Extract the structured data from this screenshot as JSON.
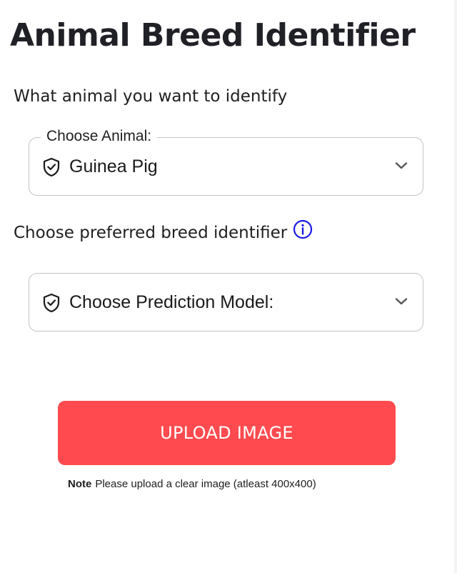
{
  "header": {
    "title": "Animal Breed Identifier"
  },
  "animal_section": {
    "label": "What animal you want to identify",
    "select": {
      "legend": "Choose Animal:",
      "selected_value": "Guinea Pig",
      "leading_icon": "shield-check-icon",
      "trailing_icon": "chevron-down-icon"
    }
  },
  "model_section": {
    "label": "Choose preferred breed identifier",
    "info_icon": "info-circle-icon",
    "select": {
      "placeholder": "Choose Prediction Model:",
      "leading_icon": "shield-check-icon",
      "trailing_icon": "chevron-down-icon"
    }
  },
  "upload": {
    "button_label": "UPLOAD IMAGE",
    "note_prefix": "Note",
    "note_text": "Please upload a clear image (atleast 400x400)"
  },
  "colors": {
    "upload_button": "#ff4b4f",
    "info_icon": "#1a1ae6",
    "title": "#202027",
    "border": "#c4c4c4"
  }
}
